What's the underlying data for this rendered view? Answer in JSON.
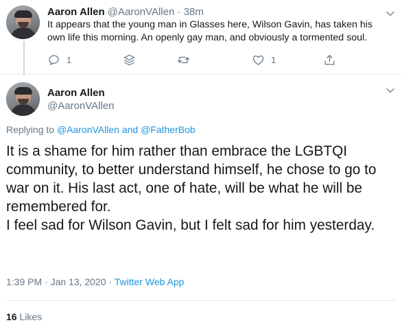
{
  "tweet1": {
    "name": "Aaron Allen",
    "handle": "@AaronVAllen",
    "separator": "·",
    "time": "38m",
    "text": "It appears that the young man in Glasses here, Wilson Gavin, has taken his own life this morning. An openly gay man, and obviously a tormented soul.",
    "actions": {
      "reply_count": "1",
      "like_count": "1"
    },
    "icons": [
      "reply-icon",
      "stack-icon",
      "retweet-icon",
      "heart-icon",
      "share-icon",
      "chevron-down-icon"
    ]
  },
  "tweet2": {
    "name": "Aaron Allen",
    "handle": "@AaronVAllen",
    "replying_prefix": "Replying to",
    "replying_user1": "@AaronVAllen",
    "replying_and": "and",
    "replying_user2": "@FatherBob",
    "paragraph1": "It is a shame for him rather than embrace the LGBTQI community, to better understand himself,  he chose to go to war on it. His last act, one of hate, will be what he will be remembered for.",
    "paragraph2": "I feel sad for Wilson Gavin, but I felt sad for him yesterday.",
    "timestamp": "1:39 PM · Jan 13, 2020",
    "meta_sep": " · ",
    "source": "Twitter Web App",
    "likes_count": "16",
    "likes_label": "Likes"
  },
  "colors": {
    "text": "#14171a",
    "secondary": "#657786",
    "link": "#1b95e0",
    "divider": "#e6ecf0"
  }
}
